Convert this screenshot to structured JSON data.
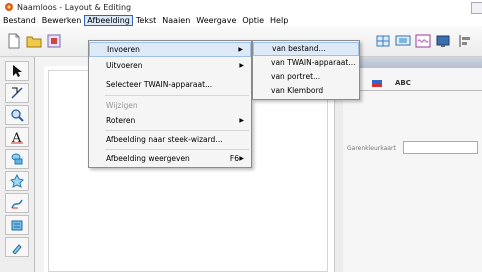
{
  "window": {
    "title": "Naamloos - Layout & Editing"
  },
  "menubar": {
    "items": [
      {
        "label": "Bestand"
      },
      {
        "label": "Bewerken"
      },
      {
        "label": "Afbeelding"
      },
      {
        "label": "Tekst"
      },
      {
        "label": "Naaien"
      },
      {
        "label": "Weergave"
      },
      {
        "label": "Optie"
      },
      {
        "label": "Help"
      }
    ]
  },
  "afbeelding_menu": {
    "items": [
      {
        "label": "Invoeren",
        "submenu": true
      },
      {
        "label": "Uitvoeren",
        "submenu": true
      },
      {
        "label": "Selecteer TWAIN-apparaat..."
      },
      {
        "label": "Wijzigen",
        "disabled": true
      },
      {
        "label": "Roteren",
        "submenu": true
      },
      {
        "label": "Afbeelding naar steek-wizard..."
      },
      {
        "label": "Afbeelding weergeven",
        "shortcut": "F6",
        "submenu": true
      }
    ]
  },
  "invoeren_submenu": {
    "items": [
      {
        "label": "van bestand..."
      },
      {
        "label": "van TWAIN-apparaat..."
      },
      {
        "label": "van portret..."
      },
      {
        "label": "van Klembord"
      }
    ]
  },
  "right_panel": {
    "tab_text": "ABC",
    "field_label": "Garenkleurkaart"
  },
  "colors": {
    "accent": "#dde9f7",
    "accent_border": "#9fc0e6",
    "menu_open": "#3366aa"
  }
}
